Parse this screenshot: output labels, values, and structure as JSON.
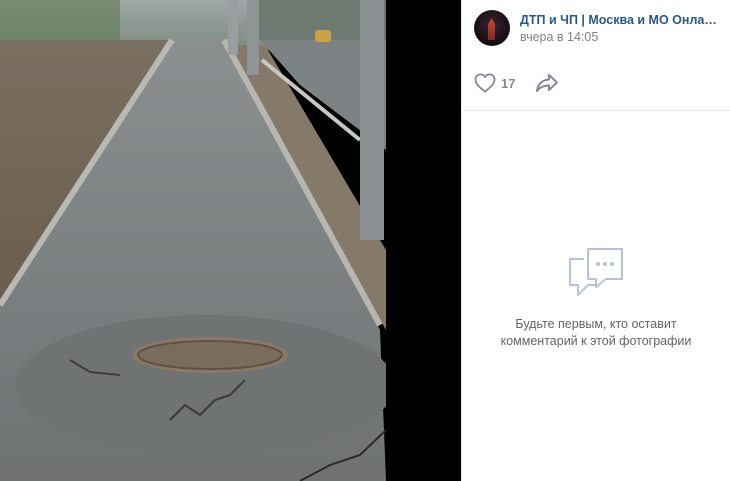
{
  "post": {
    "author_name": "ДТП и ЧП | Москва и МО Онлайн | ...",
    "date": "вчера в 14:05"
  },
  "actions": {
    "like_count": "17",
    "like_icon": "heart-outline-icon",
    "share_icon": "share-arrow-icon"
  },
  "comments": {
    "empty_line1": "Будьте первым, кто оставит",
    "empty_line2": "комментарий к этой фотографии",
    "empty_icon": "chat-bubbles-icon"
  },
  "colors": {
    "link": "#2a5885",
    "muted": "#828282",
    "icon": "#828a99",
    "empty_icon": "#b4c3d6"
  }
}
